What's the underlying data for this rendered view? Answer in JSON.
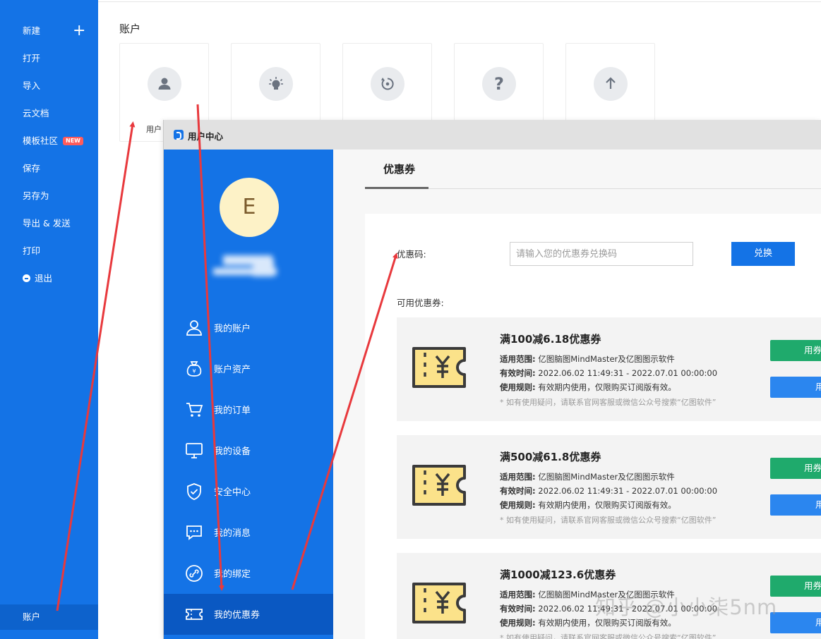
{
  "app_sidebar": {
    "items": [
      {
        "label": "新建"
      },
      {
        "label": "打开"
      },
      {
        "label": "导入"
      },
      {
        "label": "云文档"
      },
      {
        "label": "模板社区",
        "badge": "NEW"
      },
      {
        "label": "保存"
      },
      {
        "label": "另存为"
      },
      {
        "label": "导出 & 发送"
      },
      {
        "label": "打印"
      },
      {
        "label": "退出"
      }
    ],
    "active_label": "账户",
    "accent": "#1473e6"
  },
  "account": {
    "title": "账户",
    "cards": [
      {
        "icon": "user-icon",
        "label": "用户"
      },
      {
        "icon": "lightbulb-icon",
        "label": ""
      },
      {
        "icon": "refresh-icon",
        "label": ""
      },
      {
        "icon": "question-icon",
        "label": ""
      },
      {
        "icon": "upload-arrow-icon",
        "label": ""
      }
    ]
  },
  "user_center": {
    "window_title": "用户中心",
    "avatar_letter": "E",
    "menu": [
      {
        "icon": "user-icon",
        "label": "我的账户"
      },
      {
        "icon": "money-bag-icon",
        "label": "账户资产"
      },
      {
        "icon": "cart-icon",
        "label": "我的订单"
      },
      {
        "icon": "monitor-icon",
        "label": "我的设备"
      },
      {
        "icon": "shield-icon",
        "label": "安全中心"
      },
      {
        "icon": "message-icon",
        "label": "我的消息"
      },
      {
        "icon": "link-icon",
        "label": "我的绑定"
      },
      {
        "icon": "ticket-icon",
        "label": "我的优惠券",
        "active": true
      }
    ],
    "tab": "优惠券",
    "code_label": "优惠码:",
    "code_placeholder": "请输入您的优惠券兑换码",
    "redeem_label": "兑换",
    "available_label": "可用优惠券:",
    "coupons": [
      {
        "title": "满100减6.18优惠券",
        "scope_key": "适用范围:",
        "scope": "亿图脑图MindMaster及亿图图示软件",
        "time_key": "有效时间:",
        "time": "2022.06.02 11:49:31 - 2022.07.01 00:00:00",
        "rule_key": "使用规则:",
        "rule": "有效期内使用，仅限购买订阅版有效。",
        "note": "* 如有使用疑问，请联系官网客服或微信公众号搜索“亿图软件”",
        "btn1": "用券",
        "btn2": "用"
      },
      {
        "title": "满500减61.8优惠券",
        "scope_key": "适用范围:",
        "scope": "亿图脑图MindMaster及亿图图示软件",
        "time_key": "有效时间:",
        "time": "2022.06.02 11:49:31 - 2022.07.01 00:00:00",
        "rule_key": "使用规则:",
        "rule": "有效期内使用，仅限购买订阅版有效。",
        "note": "* 如有使用疑问，请联系官网客服或微信公众号搜索“亿图软件”",
        "btn1": "用券",
        "btn2": "用"
      },
      {
        "title": "满1000减123.6优惠券",
        "scope_key": "适用范围:",
        "scope": "亿图脑图MindMaster及亿图图示软件",
        "time_key": "有效时间:",
        "time": "2022.06.02 11:49:31 - 2022.07.01 00:00:00",
        "rule_key": "使用规则:",
        "rule": "有效期内使用，仅限购买订阅版有效。",
        "note": "* 如有使用疑问，请联系官网客服或微信公众号搜索“亿图软件”",
        "btn1": "用券",
        "btn2": "用"
      }
    ]
  },
  "watermark": "知乎 @小小柒5nm",
  "colors": {
    "sidebar_blue": "#1473e6",
    "active_blue": "#0a58c2",
    "green_button": "#1faa6c",
    "annotation_red": "#e8393d",
    "coupon_yellow": "#fbe28a"
  }
}
